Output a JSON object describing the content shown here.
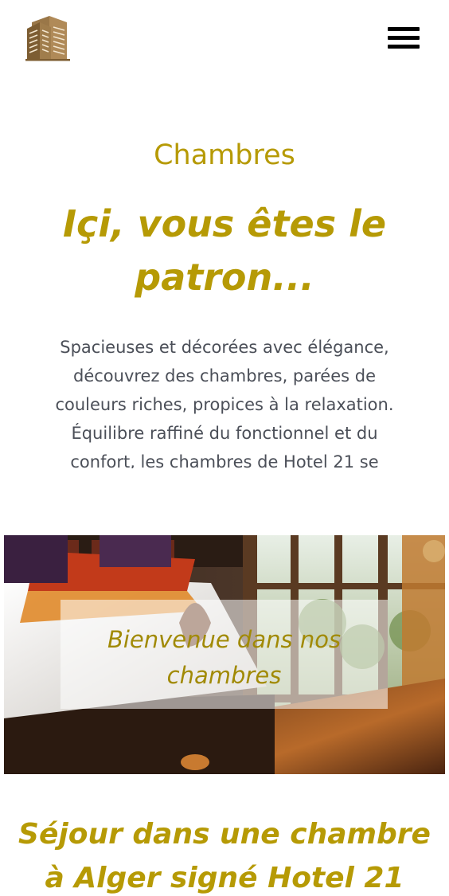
{
  "header": {
    "logo_icon": "hotel-building-icon",
    "menu_icon": "hamburger-menu-icon"
  },
  "section": {
    "title": "Chambres",
    "headline": "Içi, vous êtes le patron...",
    "intro": "Spacieuses et décorées avec élégance, découvrez des chambres, parées de couleurs riches, propices à la relaxation. Équilibre raffiné du fonctionnel et du confort, les chambres de Hotel 21 se"
  },
  "hero": {
    "welcome": "Bienvenue dans nos chambres"
  },
  "bottom": {
    "title": "Séjour dans une chambre à Alger signé Hotel 21"
  },
  "colors": {
    "accent": "#b69a05",
    "body_text": "#4b4f58",
    "logo_brown": "#8b6a3e"
  }
}
